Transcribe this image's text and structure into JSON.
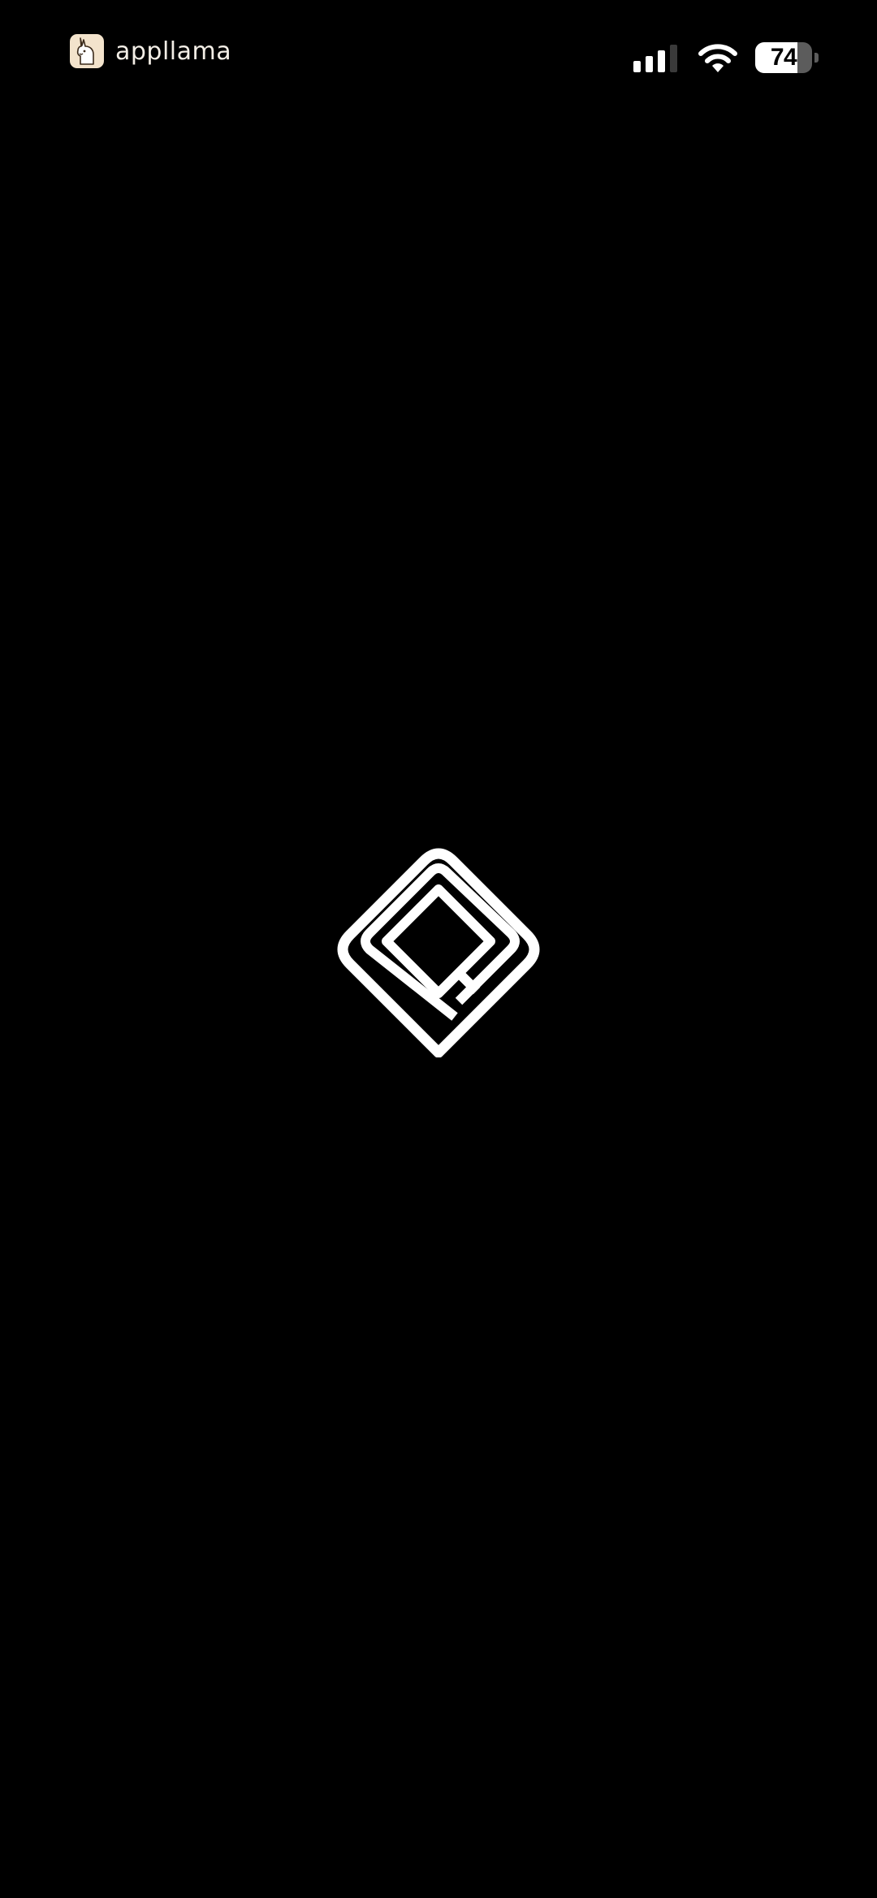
{
  "status_bar": {
    "brand": {
      "name": "appllama",
      "icon": "llama-icon"
    },
    "signal": {
      "icon": "cellular-signal-icon",
      "bars_active": 3,
      "bars_total": 4
    },
    "wifi": {
      "icon": "wifi-icon"
    },
    "battery": {
      "icon": "battery-icon",
      "level_text": "74",
      "level_percent": 74
    }
  },
  "splash": {
    "logo_icon": "app-logo-icon"
  },
  "colors": {
    "background": "#000000",
    "foreground": "#ffffff",
    "brand_icon_bg": "#f3e3cc",
    "battery_empty": "#5c5c5c"
  }
}
